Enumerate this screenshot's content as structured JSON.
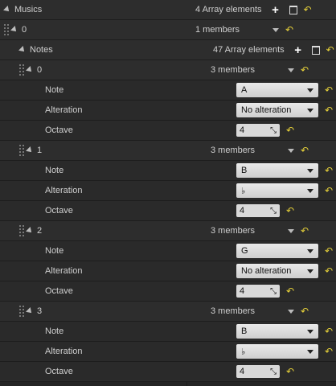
{
  "root": {
    "label": "Musics",
    "summary": "4 Array elements"
  },
  "music0": {
    "label": "0",
    "summary": "1 members"
  },
  "notes": {
    "label": "Notes",
    "summary": "47 Array elements"
  },
  "fields": {
    "note": "Note",
    "alteration": "Alteration",
    "octave": "Octave"
  },
  "items": [
    {
      "index": "0",
      "summary": "3 members",
      "note": "A",
      "alteration": "No alteration",
      "octave": "4"
    },
    {
      "index": "1",
      "summary": "3 members",
      "note": "B",
      "alteration": "♭",
      "octave": "4"
    },
    {
      "index": "2",
      "summary": "3 members",
      "note": "G",
      "alteration": "No alteration",
      "octave": "4"
    },
    {
      "index": "3",
      "summary": "3 members",
      "note": "B",
      "alteration": "♭",
      "octave": "4"
    }
  ],
  "icons": {
    "add": "plus-icon",
    "delete": "trash-icon",
    "reset": "reset-arrow-icon",
    "expand": "expand-triangle-icon",
    "dropdown": "chevron-down-icon"
  },
  "colors": {
    "background": "#242424",
    "reset": "#e6d13a",
    "text": "#cfcfcf"
  }
}
